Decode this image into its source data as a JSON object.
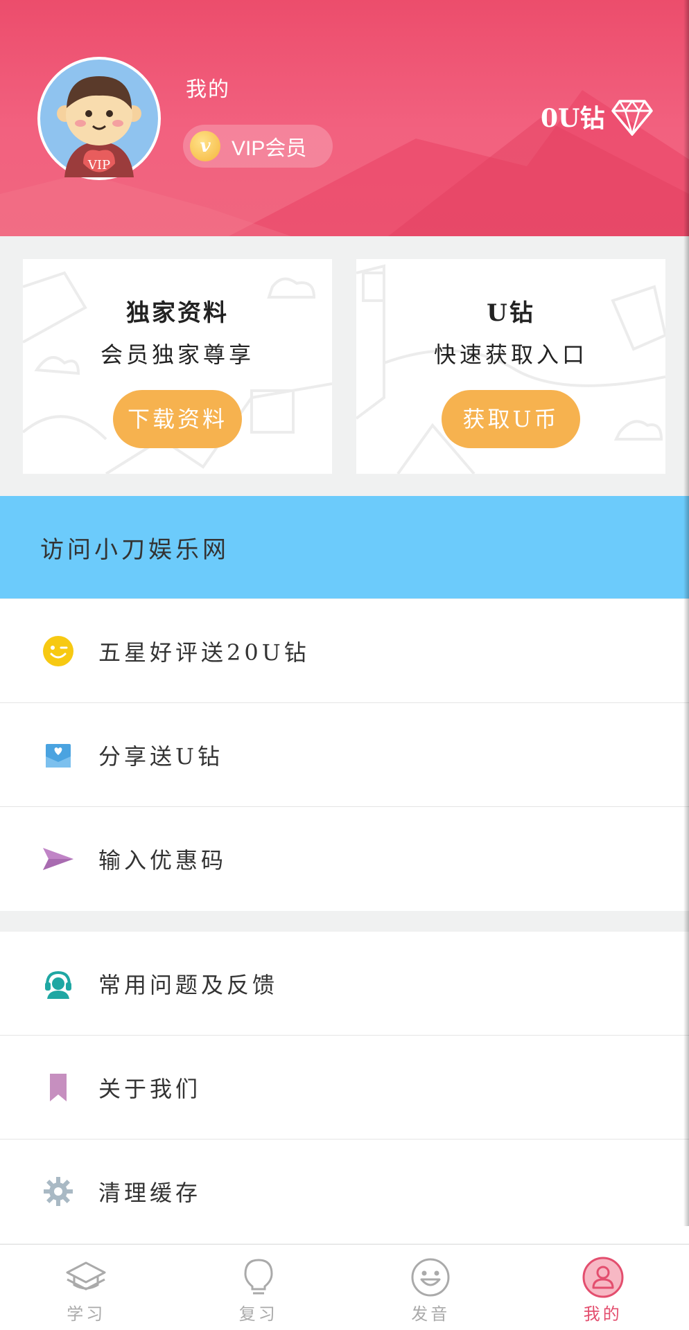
{
  "header": {
    "title": "我的",
    "vip_label": "VIP会员",
    "vip_coin_glyph": "v",
    "avatar_badge": "VIP",
    "diamond_count": "0U钻",
    "bg_color": "#ec4d6c"
  },
  "cards": [
    {
      "title": "独家资料",
      "subtitle": "会员独家尊享",
      "button": "下载资料"
    },
    {
      "title": "U钻",
      "subtitle": "快速获取入口",
      "button": "获取U币"
    }
  ],
  "banner": {
    "label": "访问小刀娱乐网",
    "color": "#6ccbfb"
  },
  "list_primary": [
    {
      "label": "五星好评送20U钻",
      "icon": "smiley-wink-icon"
    },
    {
      "label": "分享送U钻",
      "icon": "share-envelope-icon"
    },
    {
      "label": "输入优惠码",
      "icon": "paper-plane-icon"
    }
  ],
  "list_secondary": [
    {
      "label": "常用问题及反馈",
      "icon": "headset-support-icon"
    },
    {
      "label": "关于我们",
      "icon": "bookmark-icon"
    },
    {
      "label": "清理缓存",
      "icon": "gear-icon"
    }
  ],
  "tabs": [
    {
      "label": "学习",
      "icon": "graduation-cap-icon",
      "active": false
    },
    {
      "label": "复习",
      "icon": "lightbulb-icon",
      "active": false
    },
    {
      "label": "发音",
      "icon": "smile-face-icon",
      "active": false
    },
    {
      "label": "我的",
      "icon": "user-profile-icon",
      "active": true
    }
  ],
  "colors": {
    "accent": "#e34e6e",
    "button": "#f6b24f",
    "inactive_tab": "#aaaaaa"
  }
}
